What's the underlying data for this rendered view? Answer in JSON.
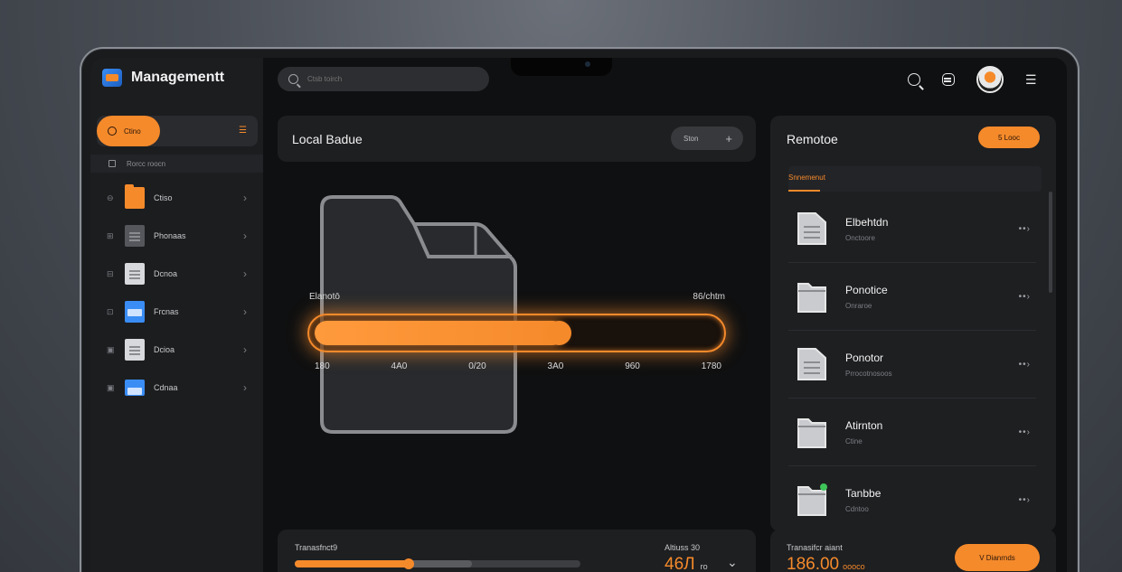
{
  "app": {
    "title": "Managementt"
  },
  "search": {
    "placeholder": "Ctsb toirch"
  },
  "sidebar": {
    "active": {
      "label": "Ctino",
      "menu_icon": "menu-icon"
    },
    "section_label": "Rorcc roocn",
    "items": [
      {
        "label": "Ctiso",
        "icon": "folder-icon",
        "color": "#f58a2b"
      },
      {
        "label": "Phonaas",
        "icon": "document-icon",
        "color": "#55575c"
      },
      {
        "label": "Dcnoa",
        "icon": "document-icon",
        "color": "#d7d9dc"
      },
      {
        "label": "Frcnas",
        "icon": "document-icon",
        "color": "#3a8df5"
      },
      {
        "label": "Dcioa",
        "icon": "document-icon",
        "color": "#d7d9dc"
      },
      {
        "label": "Cdnaa",
        "icon": "window-icon",
        "color": "#3a8df5"
      }
    ]
  },
  "local": {
    "title": "Local Badue",
    "button": "Ston",
    "progress_left": "Elanotō",
    "progress_right": "86/chtm",
    "progress_percent": 62,
    "ticks": [
      "180",
      "4A0",
      "0/20",
      "3A0",
      "960",
      "1780"
    ]
  },
  "transfer": {
    "label": "Tranasfnct9",
    "progress_percent": 40,
    "secondary_percent": 62,
    "right_label": "Altiuss 30",
    "value": "46Л",
    "unit": "ro"
  },
  "remote": {
    "title": "Remotoe",
    "button": "5 Looc",
    "tab": "Snnemenut",
    "items": [
      {
        "name": "Elbehtdn",
        "sub": "Onctoore",
        "icon": "document-icon"
      },
      {
        "name": "Ponotice",
        "sub": "Onraroe",
        "icon": "folder-icon"
      },
      {
        "name": "Ponotor",
        "sub": "Prrocotnosoos",
        "icon": "document-icon"
      },
      {
        "name": "Atirnton",
        "sub": "Ctine",
        "icon": "folder-icon"
      },
      {
        "name": "Tanbbe",
        "sub": "Cdntoo",
        "icon": "folder-icon"
      }
    ]
  },
  "status": {
    "label": "Tranasifcr aiant",
    "value": "186.00",
    "sub": "oooco",
    "button": "V Dianrnds"
  },
  "colors": {
    "accent": "#f58a2b",
    "panel": "#1e1f21",
    "background": "#0f1011"
  }
}
